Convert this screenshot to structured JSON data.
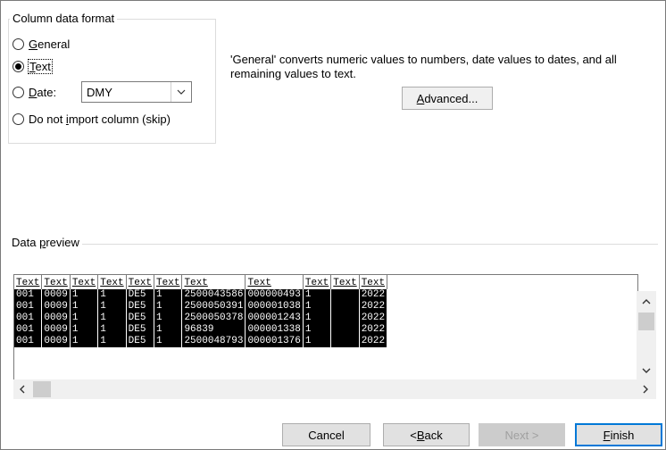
{
  "format_group": {
    "legend": "Column data format",
    "options": [
      {
        "label_pre": "",
        "label_ul": "G",
        "label_post": "eneral",
        "checked": false
      },
      {
        "label_pre": "",
        "label_ul": "T",
        "label_post": "ext",
        "checked": true
      },
      {
        "label_pre": "",
        "label_ul": "D",
        "label_post": "ate:",
        "checked": false
      },
      {
        "label_pre": "Do not ",
        "label_ul": "i",
        "label_post": "mport column (skip)",
        "checked": false
      }
    ],
    "date_select_value": "DMY"
  },
  "description": "'General' converts numeric values to numbers, date values to dates, and all remaining values to text.",
  "advanced_button": {
    "pre": "",
    "ul": "A",
    "post": "dvanced..."
  },
  "preview": {
    "legend_pre": "Data ",
    "legend_ul": "p",
    "legend_post": "review",
    "headers": [
      "Text",
      "Text",
      "Text",
      "Text",
      "Text",
      "Text",
      "Text",
      "Text",
      "Text",
      "Text",
      "Text"
    ],
    "rows": [
      [
        "001",
        "0009",
        "1",
        "1",
        "DE5",
        "1",
        "2500043586",
        "000000493",
        "1",
        "",
        "2022"
      ],
      [
        "001",
        "0009",
        "1",
        "1",
        "DE5",
        "1",
        "2500050391",
        "000001038",
        "1",
        "",
        "2022"
      ],
      [
        "001",
        "0009",
        "1",
        "1",
        "DE5",
        "1",
        "2500050378",
        "000001243",
        "1",
        "",
        "2022"
      ],
      [
        "001",
        "0009",
        "1",
        "1",
        "DE5",
        "1",
        "96839",
        "000001338",
        "1",
        "",
        "2022"
      ],
      [
        "001",
        "0009",
        "1",
        "1",
        "DE5",
        "1",
        "2500048793",
        "000001376",
        "1",
        "",
        "2022"
      ]
    ]
  },
  "buttons": {
    "cancel": "Cancel",
    "back": {
      "pre": "< ",
      "ul": "B",
      "post": "ack"
    },
    "next": "Next >",
    "finish": {
      "pre": "",
      "ul": "F",
      "post": "inish"
    }
  },
  "icons": {
    "dropdown": "chevron-down-icon",
    "scroll_up": "chevron-up-icon",
    "scroll_down": "chevron-down-icon",
    "scroll_left": "chevron-left-icon",
    "scroll_right": "chevron-right-icon"
  },
  "colors": {
    "accent": "#0078d7",
    "preview_cell_bg": "#000000",
    "preview_cell_text": "#ffffff"
  }
}
